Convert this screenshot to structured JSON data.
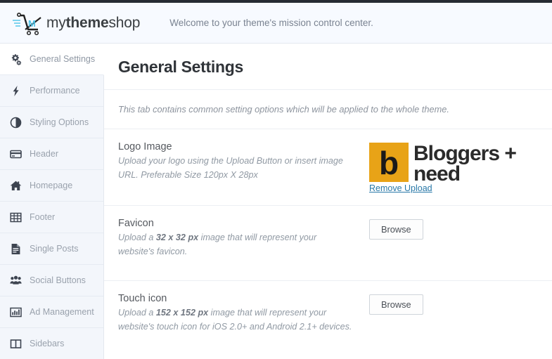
{
  "topbar": {
    "accent_color": "#262b33"
  },
  "header": {
    "logo_icon": "shopping-cart-logo",
    "brand_part1": "my",
    "brand_part2": "theme",
    "brand_part3": "shop",
    "welcome": "Welcome to your theme's mission control center."
  },
  "sidebar": {
    "items": [
      {
        "label": "General Settings",
        "icon": "gears-icon",
        "active": true
      },
      {
        "label": "Performance",
        "icon": "bolt-icon",
        "active": false
      },
      {
        "label": "Styling Options",
        "icon": "contrast-circle-icon",
        "active": false
      },
      {
        "label": "Header",
        "icon": "credit-card-icon",
        "active": false
      },
      {
        "label": "Homepage",
        "icon": "home-icon",
        "active": false
      },
      {
        "label": "Footer",
        "icon": "table-grid-icon",
        "active": false
      },
      {
        "label": "Single Posts",
        "icon": "file-text-icon",
        "active": false
      },
      {
        "label": "Social Buttons",
        "icon": "users-group-icon",
        "active": false
      },
      {
        "label": "Ad Management",
        "icon": "bar-chart-icon",
        "active": false
      },
      {
        "label": "Sidebars",
        "icon": "columns-icon",
        "active": false
      }
    ]
  },
  "main": {
    "page_title": "General Settings",
    "intro": "This tab contains common setting options which will be applied to the whole theme.",
    "rows": [
      {
        "name": "Logo Image",
        "desc_before": "Upload your logo using the Upload Button or insert image URL. Preferable Size 120px X 28px",
        "desc_bold": "",
        "desc_after": "",
        "control": "logo-preview",
        "preview": {
          "mark_letter": "b",
          "mark_color": "#e8a317",
          "word_line1": "Bloggers +",
          "word_line2": "need",
          "remove_label": "Remove Upload",
          "link_color": "#2878a8"
        }
      },
      {
        "name": "Favicon",
        "desc_before": "Upload a ",
        "desc_bold": "32 x 32 px",
        "desc_after": " image that will represent your website's favicon.",
        "control": "browse",
        "button_label": "Browse"
      },
      {
        "name": "Touch icon",
        "desc_before": "Upload a ",
        "desc_bold": "152 x 152 px",
        "desc_after": " image that will represent your website's touch icon for iOS 2.0+ and Android 2.1+ devices.",
        "control": "browse",
        "button_label": "Browse"
      }
    ]
  }
}
